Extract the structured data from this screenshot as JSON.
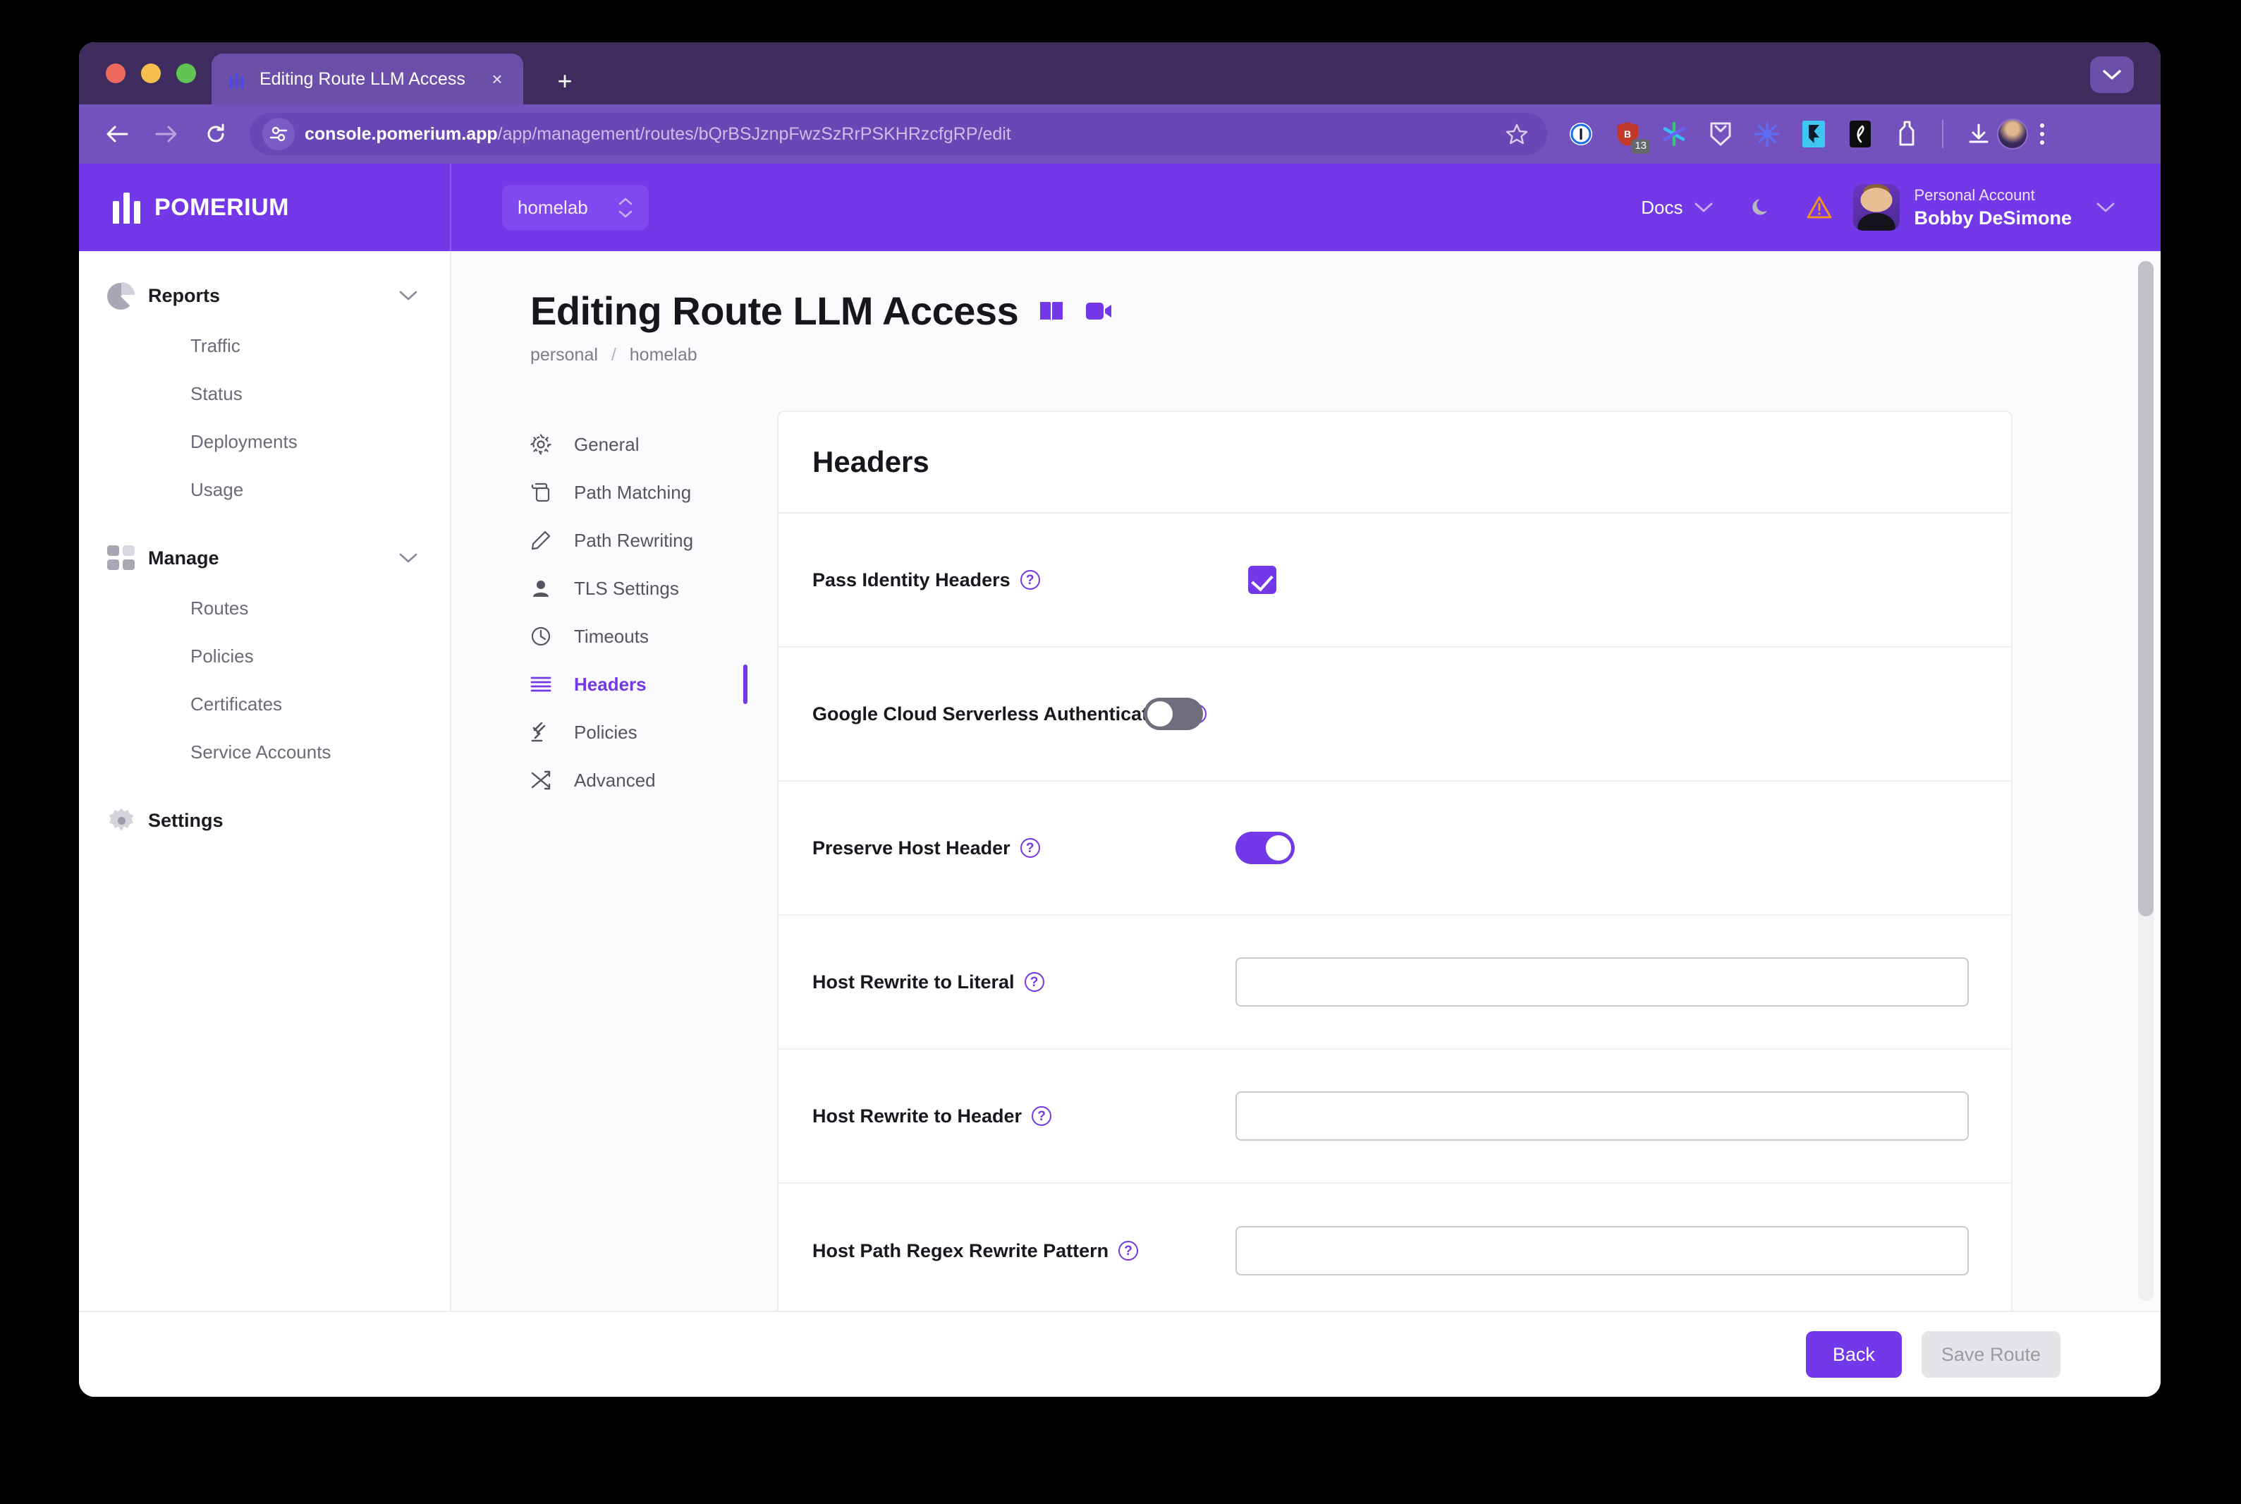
{
  "browser": {
    "tab": {
      "title": "Editing Route LLM Access",
      "favicon": "pomerium-icon",
      "close": "×"
    },
    "new_tab_label": "+",
    "window_menu_icon": "chevron-down-icon",
    "url": {
      "domain": "console.pomerium.app",
      "path": "/app/management/routes/bQrBSJznpFwzSzRrPSKHRzcfgRP/edit",
      "full": "console.pomerium.app/app/management/routes/bQrBSJznpFwzSzRrPSKHRzcfgRP/edit"
    },
    "extensions": [
      {
        "name": "1password-extension-icon",
        "badge": ""
      },
      {
        "name": "shield-extension-icon",
        "badge": "13"
      },
      {
        "name": "asterisk-extension-icon",
        "badge": ""
      },
      {
        "name": "chevron-extension-icon",
        "badge": ""
      },
      {
        "name": "sunburst-extension-icon",
        "badge": ""
      },
      {
        "name": "framer-extension-icon",
        "badge": ""
      },
      {
        "name": "pen-extension-icon",
        "badge": ""
      },
      {
        "name": "bottle-extension-icon",
        "badge": ""
      }
    ],
    "download_icon": "download-icon",
    "profile_icon": "profile-avatar",
    "menu_icon": "kebab-menu-icon"
  },
  "header": {
    "brand": "POMERIUM",
    "workspace": "homelab",
    "docs_label": "Docs",
    "theme_icon": "moon-icon",
    "alert_icon": "warning-triangle-icon",
    "account_type": "Personal Account",
    "account_name": "Bobby DeSimone",
    "accent_color": "#7339e8"
  },
  "sidebar": {
    "groups": [
      {
        "label": "Reports",
        "icon": "pie-chart-icon",
        "items": [
          {
            "label": "Traffic"
          },
          {
            "label": "Status"
          },
          {
            "label": "Deployments"
          },
          {
            "label": "Usage"
          }
        ]
      },
      {
        "label": "Manage",
        "icon": "grid-icon",
        "items": [
          {
            "label": "Routes"
          },
          {
            "label": "Policies"
          },
          {
            "label": "Certificates"
          },
          {
            "label": "Service Accounts"
          }
        ]
      }
    ],
    "settings": {
      "label": "Settings",
      "icon": "gear-icon"
    }
  },
  "page": {
    "title": "Editing Route LLM Access",
    "title_icons": [
      "book-icon",
      "video-icon"
    ],
    "breadcrumb": {
      "parent": "personal",
      "separator": "/",
      "current": "homelab"
    }
  },
  "tabs": [
    {
      "label": "General",
      "icon": "gear-icon",
      "active": false
    },
    {
      "label": "Path Matching",
      "icon": "copy-icon",
      "active": false
    },
    {
      "label": "Path Rewriting",
      "icon": "pencil-icon",
      "active": false
    },
    {
      "label": "TLS Settings",
      "icon": "person-icon",
      "active": false
    },
    {
      "label": "Timeouts",
      "icon": "clock-icon",
      "active": false
    },
    {
      "label": "Headers",
      "icon": "lines-icon",
      "active": true
    },
    {
      "label": "Policies",
      "icon": "gavel-icon",
      "active": false
    },
    {
      "label": "Advanced",
      "icon": "shuffle-icon",
      "active": false
    }
  ],
  "card": {
    "title": "Headers",
    "rows": [
      {
        "label": "Pass Identity Headers",
        "control": "checkbox",
        "value": "checked",
        "help": "?"
      },
      {
        "label": "Google Cloud Serverless Authentication",
        "control": "toggle",
        "value": "off",
        "help": "?"
      },
      {
        "label": "Preserve Host Header",
        "control": "toggle",
        "value": "on",
        "help": "?"
      },
      {
        "label": "Host Rewrite to Literal",
        "control": "text",
        "value": "",
        "placeholder": "",
        "help": "?"
      },
      {
        "label": "Host Rewrite to Header",
        "control": "text",
        "value": "",
        "placeholder": "",
        "help": "?"
      },
      {
        "label": "Host Path Regex Rewrite Pattern",
        "control": "text",
        "value": "",
        "placeholder": "",
        "help": "?"
      }
    ]
  },
  "footer": {
    "back_label": "Back",
    "save_label": "Save Route",
    "save_disabled": true
  }
}
